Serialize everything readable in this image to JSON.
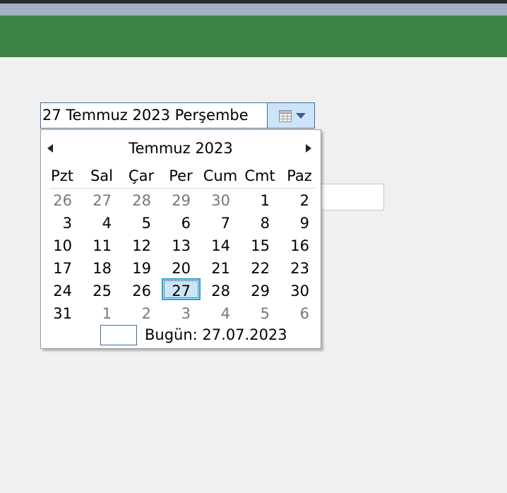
{
  "colors": {
    "top_line": "#2b2b2b",
    "title_bar": "#a2afc6",
    "header_band": "#3d8545",
    "background": "#f0f0f0",
    "accent": "#26a0da",
    "selected_fill": "#cce4f7"
  },
  "date_picker": {
    "value": "27 Temmuz 2023 Perşembe",
    "button_icon": "calendar-icon"
  },
  "calendar": {
    "month_label": "Temmuz 2023",
    "weekdays": [
      "Pzt",
      "Sal",
      "Çar",
      "Per",
      "Cum",
      "Cmt",
      "Paz"
    ],
    "weeks": [
      [
        "26",
        "27",
        "28",
        "29",
        "30",
        "1",
        "2"
      ],
      [
        "3",
        "4",
        "5",
        "6",
        "7",
        "8",
        "9"
      ],
      [
        "10",
        "11",
        "12",
        "13",
        "14",
        "15",
        "16"
      ],
      [
        "17",
        "18",
        "19",
        "20",
        "21",
        "22",
        "23"
      ],
      [
        "24",
        "25",
        "26",
        "27",
        "28",
        "29",
        "30"
      ],
      [
        "31",
        "1",
        "2",
        "3",
        "4",
        "5",
        "6"
      ]
    ],
    "other_month_mask": [
      [
        true,
        true,
        true,
        true,
        true,
        false,
        false
      ],
      [
        false,
        false,
        false,
        false,
        false,
        false,
        false
      ],
      [
        false,
        false,
        false,
        false,
        false,
        false,
        false
      ],
      [
        false,
        false,
        false,
        false,
        false,
        false,
        false
      ],
      [
        false,
        false,
        false,
        false,
        false,
        false,
        false
      ],
      [
        false,
        true,
        true,
        true,
        true,
        true,
        true
      ]
    ],
    "selected_day": "27",
    "today_text": "Bugün: 27.07.2023"
  }
}
